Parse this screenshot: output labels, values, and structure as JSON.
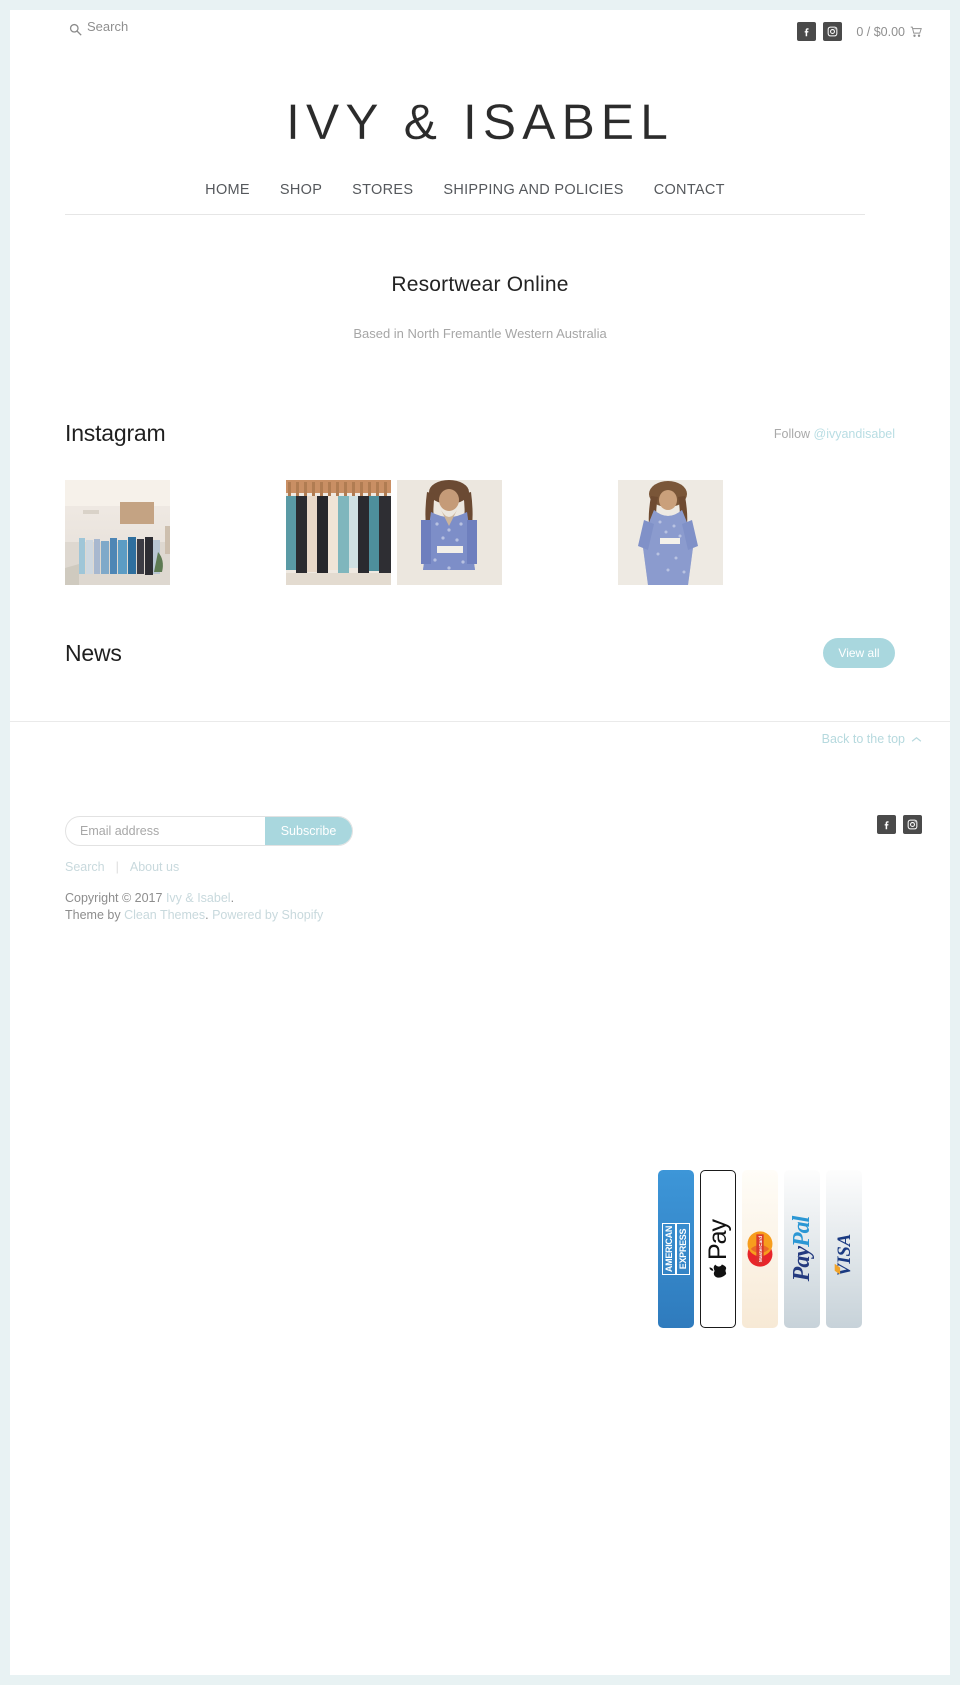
{
  "topbar": {
    "search_placeholder": "Search",
    "search_value": "",
    "search_icon": "search-icon",
    "facebook_icon": "facebook-icon",
    "instagram_icon": "instagram-icon",
    "cart_label": "0 / $0.00",
    "cart_icon": "cart-icon"
  },
  "logo": {
    "text": "IVY & ISABEL"
  },
  "nav": {
    "items": [
      {
        "label": "HOME"
      },
      {
        "label": "SHOP"
      },
      {
        "label": "STORES"
      },
      {
        "label": "SHIPPING AND POLICIES"
      },
      {
        "label": "CONTACT"
      }
    ]
  },
  "hero": {
    "title": "Resortwear Online",
    "subtitle": "Based in North Fremantle Western Australia"
  },
  "instagram": {
    "heading": "Instagram",
    "follow_prefix": "Follow ",
    "handle": "@ivyandisabel",
    "photos": [
      {
        "alt": "boutique-interior-clothing-rack"
      },
      {
        "alt": "clothing-rack-hangers"
      },
      {
        "alt": "woman-in-blue-printed-dress"
      },
      {
        "alt": "woman-in-blue-floral-kaftan"
      }
    ]
  },
  "news": {
    "heading": "News",
    "view_all_label": "View all"
  },
  "footer": {
    "back_to_top": "Back to the top",
    "back_to_top_icon": "chevron-up-icon",
    "newsletter": {
      "placeholder": "Email address",
      "value": "",
      "submit_label": "Subscribe"
    },
    "social": {
      "facebook_icon": "facebook-icon",
      "instagram_icon": "instagram-icon"
    },
    "links": [
      {
        "label": "Search"
      },
      {
        "label": "About us"
      }
    ],
    "separator": "|",
    "copyright_prefix": "Copyright © 2017 ",
    "copyright_store": "Ivy & Isabel",
    "copyright_suffix": ".",
    "theme_prefix": "Theme by ",
    "theme_name": "Clean Themes",
    "theme_mid": ". ",
    "powered_by": "Powered by Shopify"
  },
  "payments": [
    {
      "name": "american-express",
      "label": "AMERICAN EXPRESS"
    },
    {
      "name": "apple-pay",
      "label": "Pay"
    },
    {
      "name": "mastercard",
      "label": "MasterCard"
    },
    {
      "name": "paypal",
      "label": "PayPal"
    },
    {
      "name": "visa",
      "label": "VISA"
    }
  ],
  "colors": {
    "page_bg": "#e8f2f3",
    "accent": "#a9d7de",
    "text": "#2b2b2b",
    "muted": "#8f8f8f"
  }
}
